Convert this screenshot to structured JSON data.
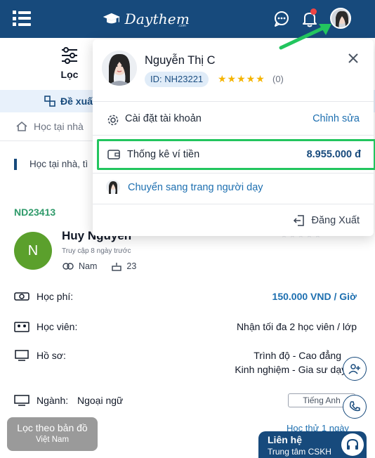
{
  "header": {
    "logo_text": "Daythem",
    "logo_sub": ".com",
    "icons": [
      "menu-icon",
      "chat-icon",
      "bell-icon"
    ],
    "notification_color": "#ef4444",
    "bg_color": "#174a7c"
  },
  "page": {
    "filter_label": "Lọc",
    "suggest_label": "Đề xuấ",
    "breadcrumb": "Học tại nhà",
    "lead_text": "Học tại nhà, tì",
    "candidate": {
      "code": "ND23413",
      "initial": "N",
      "name": "Huy Nguyễn",
      "last_access": "Truy cập 8 ngày trước",
      "gender": "Nam",
      "age": "23"
    },
    "rows": [
      {
        "label": "Học phí:",
        "value": "150.000 VND / Giờ"
      },
      {
        "label": "Học viên:",
        "value": "Nhận tối đa 2 học viên / lớp"
      },
      {
        "label": "Hồ sơ:",
        "value": "Trình độ - Cao đẳng",
        "value2": "Kinh nghiệm - Gia sư dạy k"
      },
      {
        "label": "Ngành:",
        "value": "Ngoại ngữ"
      }
    ],
    "subject_tag": "Tiếng Anh",
    "trial_link": "Học thử 1 ngày"
  },
  "floating": {
    "map_filter_title": "Lọc theo bản đồ",
    "map_filter_sub": "Việt Nam",
    "support_title": "Liên hệ",
    "support_sub": "Trung tâm CSKH"
  },
  "dropdown": {
    "name": "Nguyễn Thị C",
    "id_badge": "ID: NH23221",
    "stars": "★★★★★",
    "rating_count": "(0)",
    "settings_label": "Cài đặt tài khoản",
    "settings_action": "Chỉnh sửa",
    "wallet_label": "Thống kê ví tiền",
    "wallet_amount": "8.955.000 đ",
    "switch_label": "Chuyển sang trang người dạy",
    "logout_label": "Đăng Xuất",
    "highlight_color": "#22c55e"
  }
}
